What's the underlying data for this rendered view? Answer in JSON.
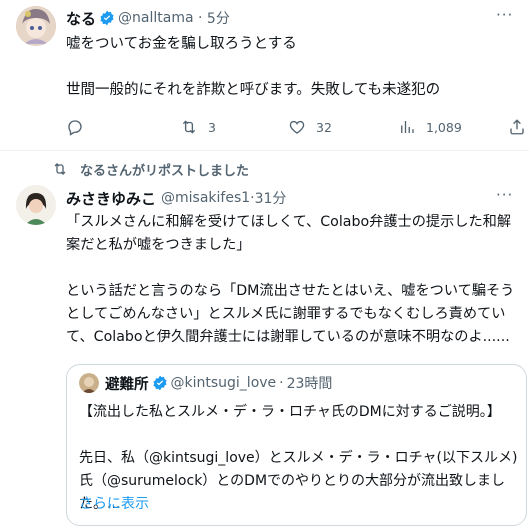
{
  "tweet1": {
    "display_name": "なる",
    "handle": "@nalltama",
    "time": "5分",
    "text_line1": "嘘をついてお金を騙し取ろうとする",
    "text_line2": "世間一般的にそれを詐欺と呼びます。失敗しても未遂犯の",
    "actions": {
      "replies": "",
      "retweets": "3",
      "likes": "32",
      "views": "1,089"
    },
    "more": "···"
  },
  "retweet_banner": "なるさんがリポストしました",
  "tweet2": {
    "display_name": "みさきゆみこ",
    "handle": "@misakifes1",
    "time": "31分",
    "separator": "·",
    "text": "「スルメさんに和解を受けてほしくて、Colabo弁護士の提示した和解案だと私が嘘をつきました」\n\nという話だと言うのなら「DM流出させたとはいえ、嘘をついて騙そうとしてごめんなさい」とスルメ氏に謝罪するでもなくむしろ責めていて、Colaboと伊久間弁護士には謝罪しているのが意味不明なのよ......",
    "more": "···"
  },
  "quote": {
    "display_name": "避難所",
    "handle": "@kintsugi_love",
    "time": "23時間",
    "separator": "·",
    "title": "【流出した私とスルメ・デ・ラ・ロチャ氏のDMに対するご説明。】",
    "body": "先日、私（@kintsugi_love）とスルメ・デ・ラ・ロチャ(以下スルメ)氏（@surumelock）とのDMでのやりとりの大部分が流出致しました。...",
    "show_more": "さらに表示"
  },
  "colors": {
    "accent": "#1d9bf0",
    "secondary_text": "#536471",
    "divider": "#eff3f4"
  }
}
